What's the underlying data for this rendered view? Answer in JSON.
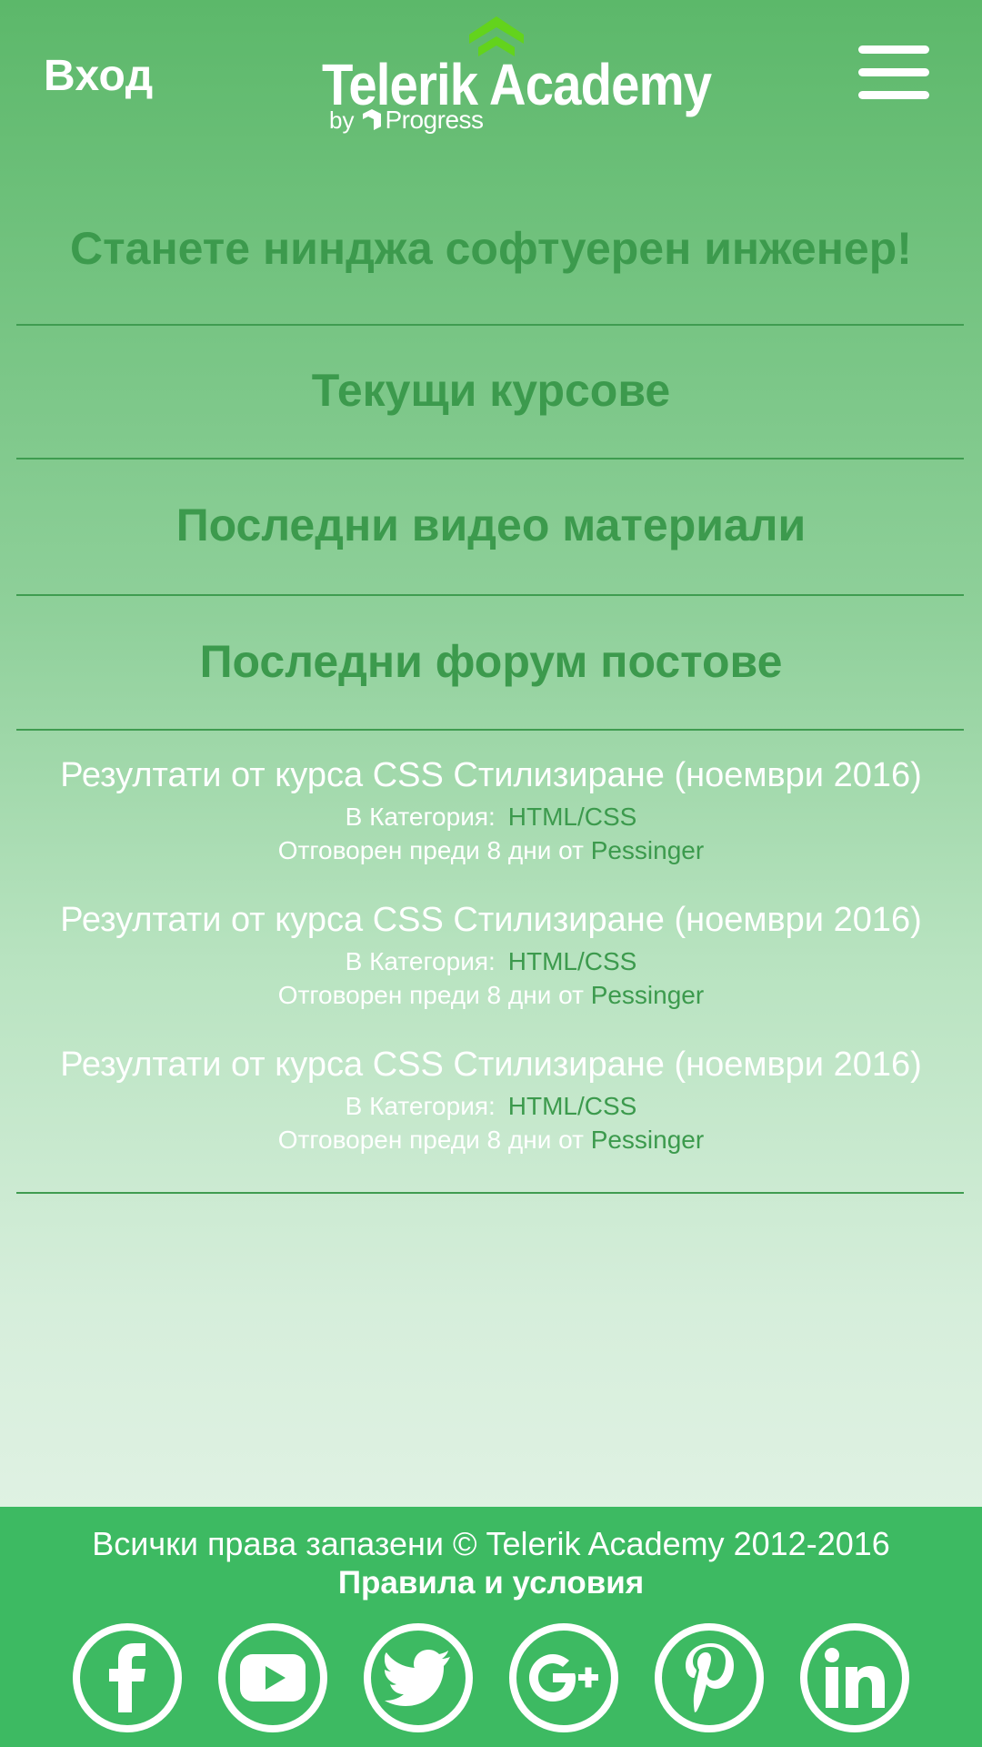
{
  "header": {
    "login_label": "Вход",
    "logo": {
      "title": "Telerik Academy",
      "by": "by",
      "progress": "Progress"
    },
    "menu_icon": "hamburger-menu-icon"
  },
  "sections": {
    "hero": "Станете нинджа софтуерен инженер!",
    "courses": "Текущи курсове",
    "videos": "Последни видео материали",
    "forum": "Последни форум постове"
  },
  "forum_posts": [
    {
      "title": "Резултати от курса CSS Стилизиране (ноември 2016)",
      "category_label": "В Категория:",
      "category": "HTML/CSS",
      "answered_text": "Отговорен преди 8 дни от",
      "author": "Pessinger"
    },
    {
      "title": "Резултати от курса CSS Стилизиране (ноември 2016)",
      "category_label": "В Категория:",
      "category": "HTML/CSS",
      "answered_text": "Отговорен преди 8 дни от",
      "author": "Pessinger"
    },
    {
      "title": "Резултати от курса CSS Стилизиране (ноември 2016)",
      "category_label": "В Категория:",
      "category": "HTML/CSS",
      "answered_text": "Отговорен преди 8 дни от",
      "author": "Pessinger"
    }
  ],
  "footer": {
    "copyright": "Всички права запазени © Telerik Academy 2012-2016",
    "terms": "Правила и условия",
    "social": [
      "facebook-icon",
      "youtube-icon",
      "twitter-icon",
      "google-plus-icon",
      "pinterest-icon",
      "linkedin-icon"
    ]
  },
  "colors": {
    "accent_green": "#3c9a4d",
    "footer_green": "#3dba62",
    "logo_chevron": "#63d31c",
    "text_white": "#ffffff"
  }
}
